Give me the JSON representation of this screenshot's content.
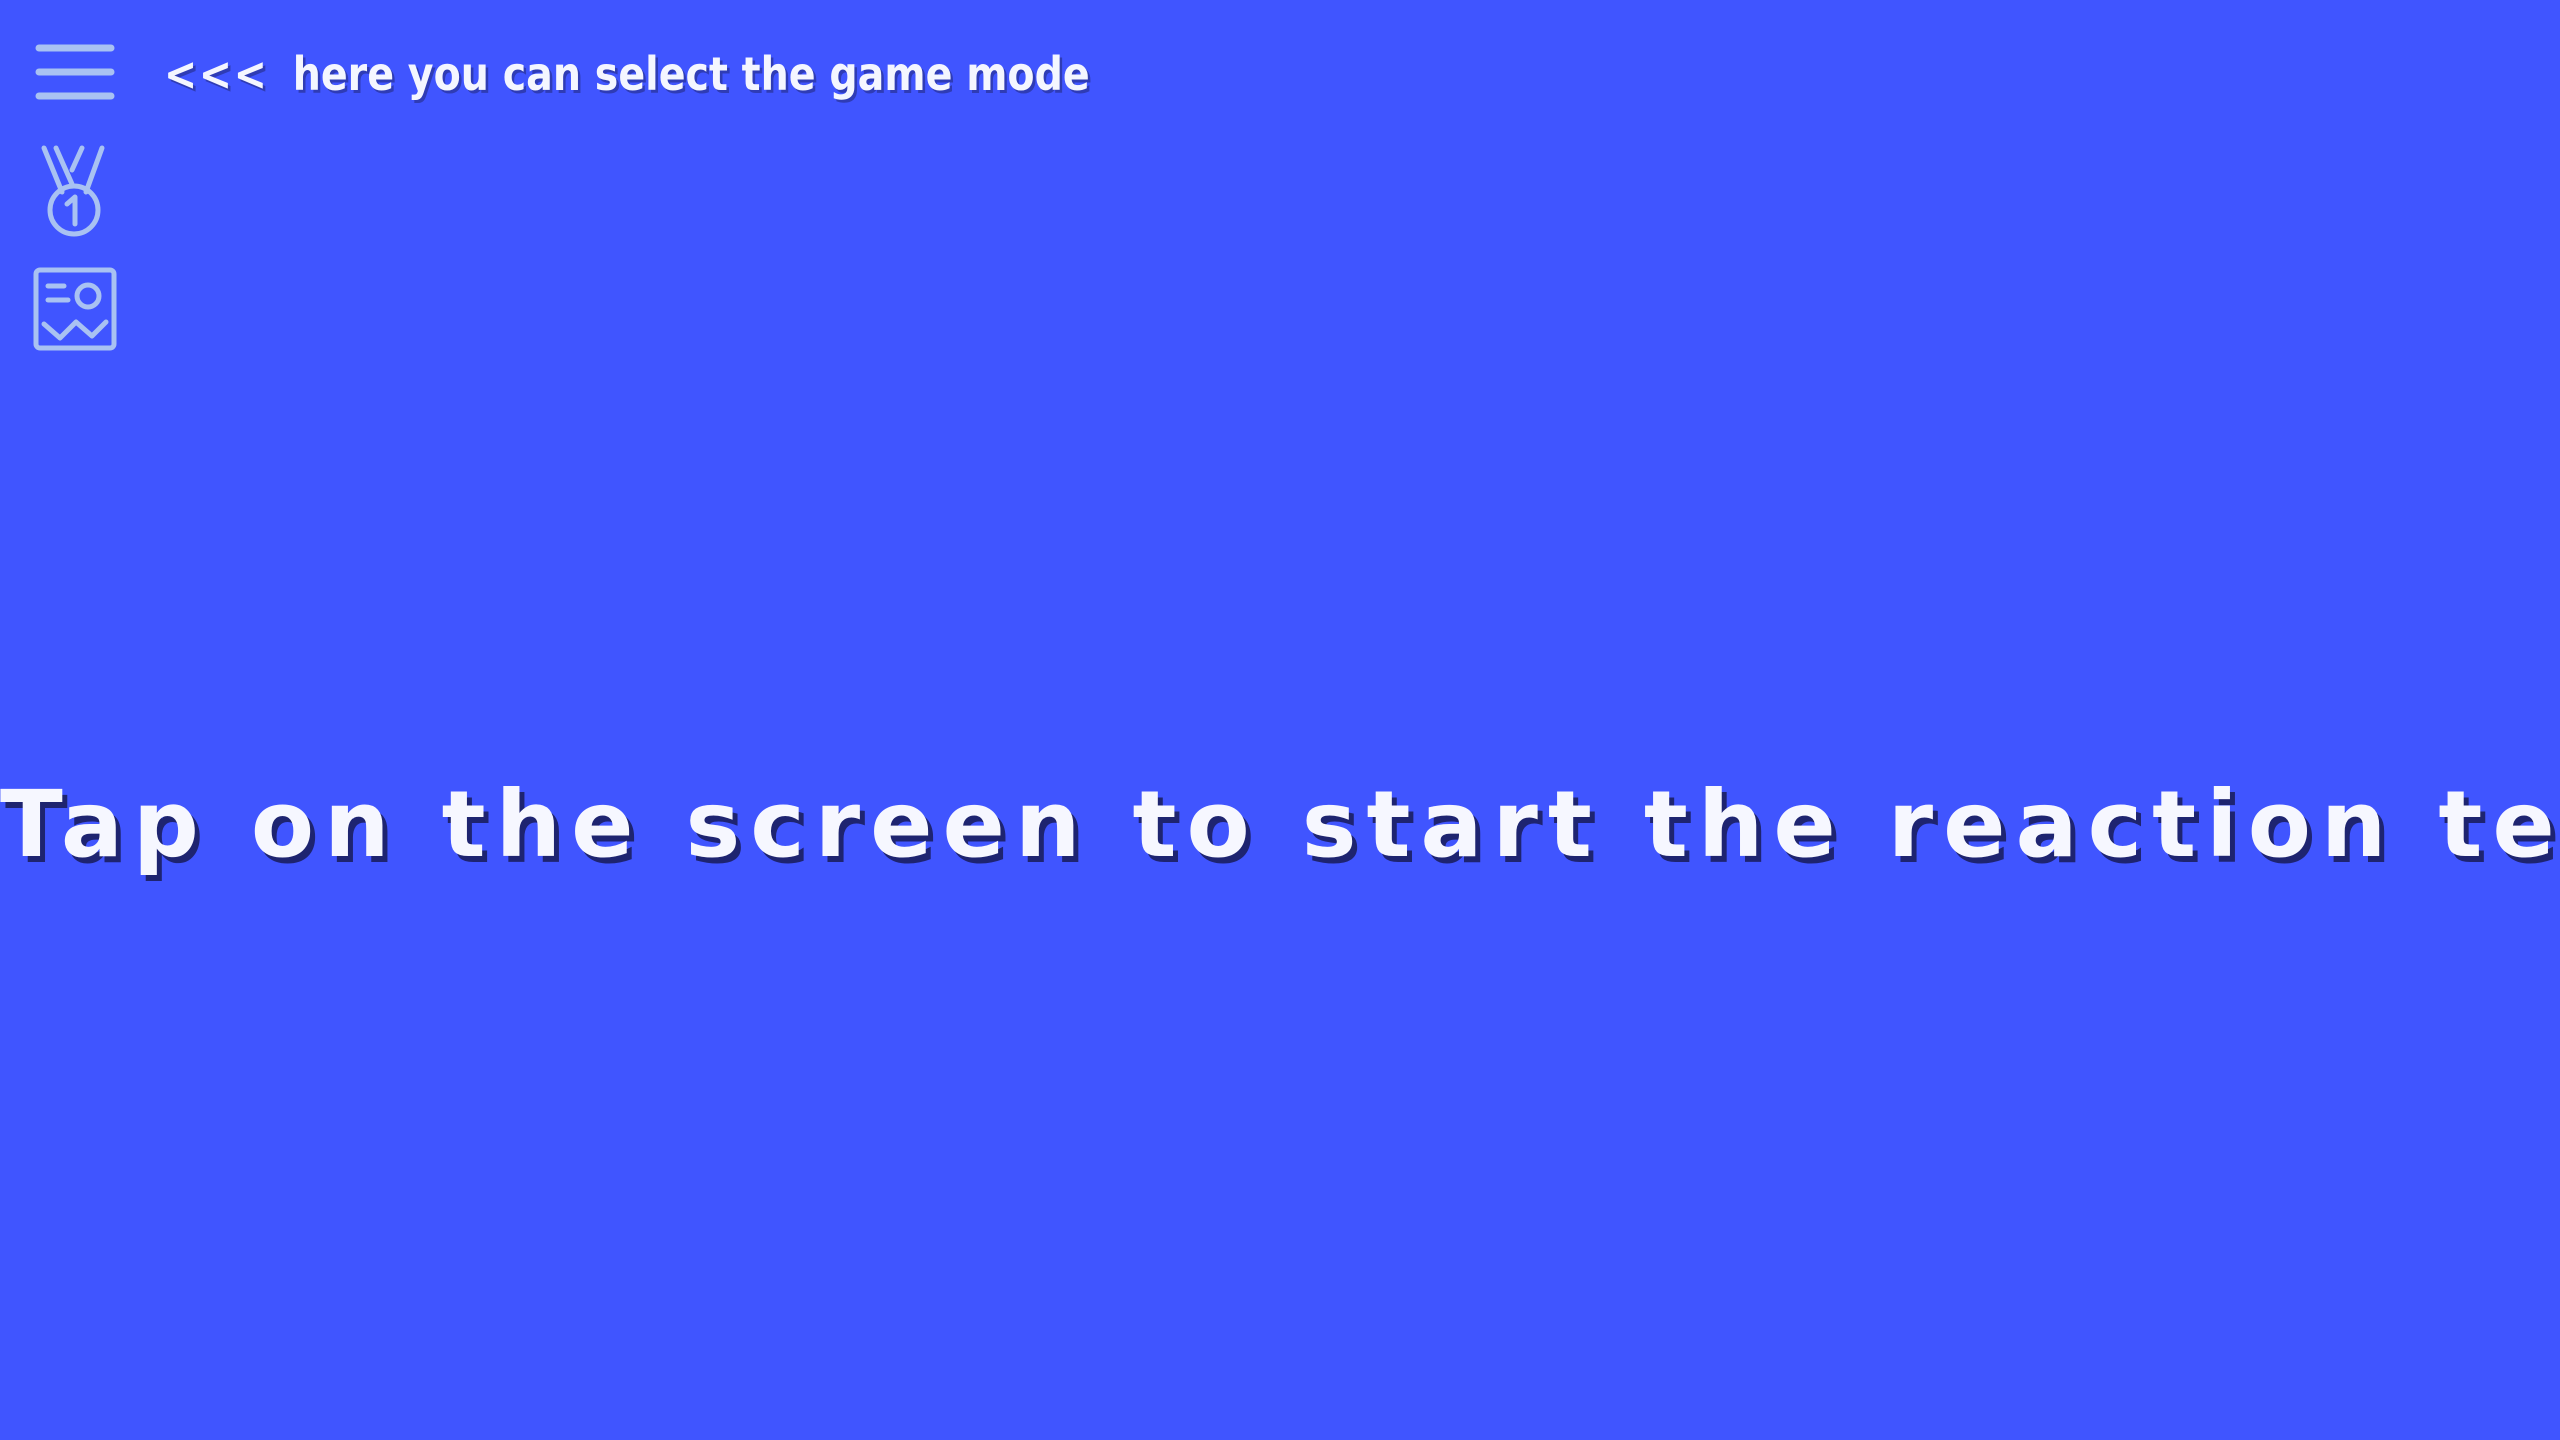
{
  "colors": {
    "background": "#4055FF",
    "text": "#F4F6FF",
    "icon": "#A9C2F2",
    "text_shadow": "#1E2470"
  },
  "sidebar": {
    "items": [
      {
        "icon": "menu-icon"
      },
      {
        "icon": "medal-icon"
      },
      {
        "icon": "image-gallery-icon"
      }
    ]
  },
  "hint": {
    "arrows": "<<<",
    "text": "here you can select the game mode"
  },
  "main": {
    "message": "Tap on the screen to start the reaction test"
  }
}
